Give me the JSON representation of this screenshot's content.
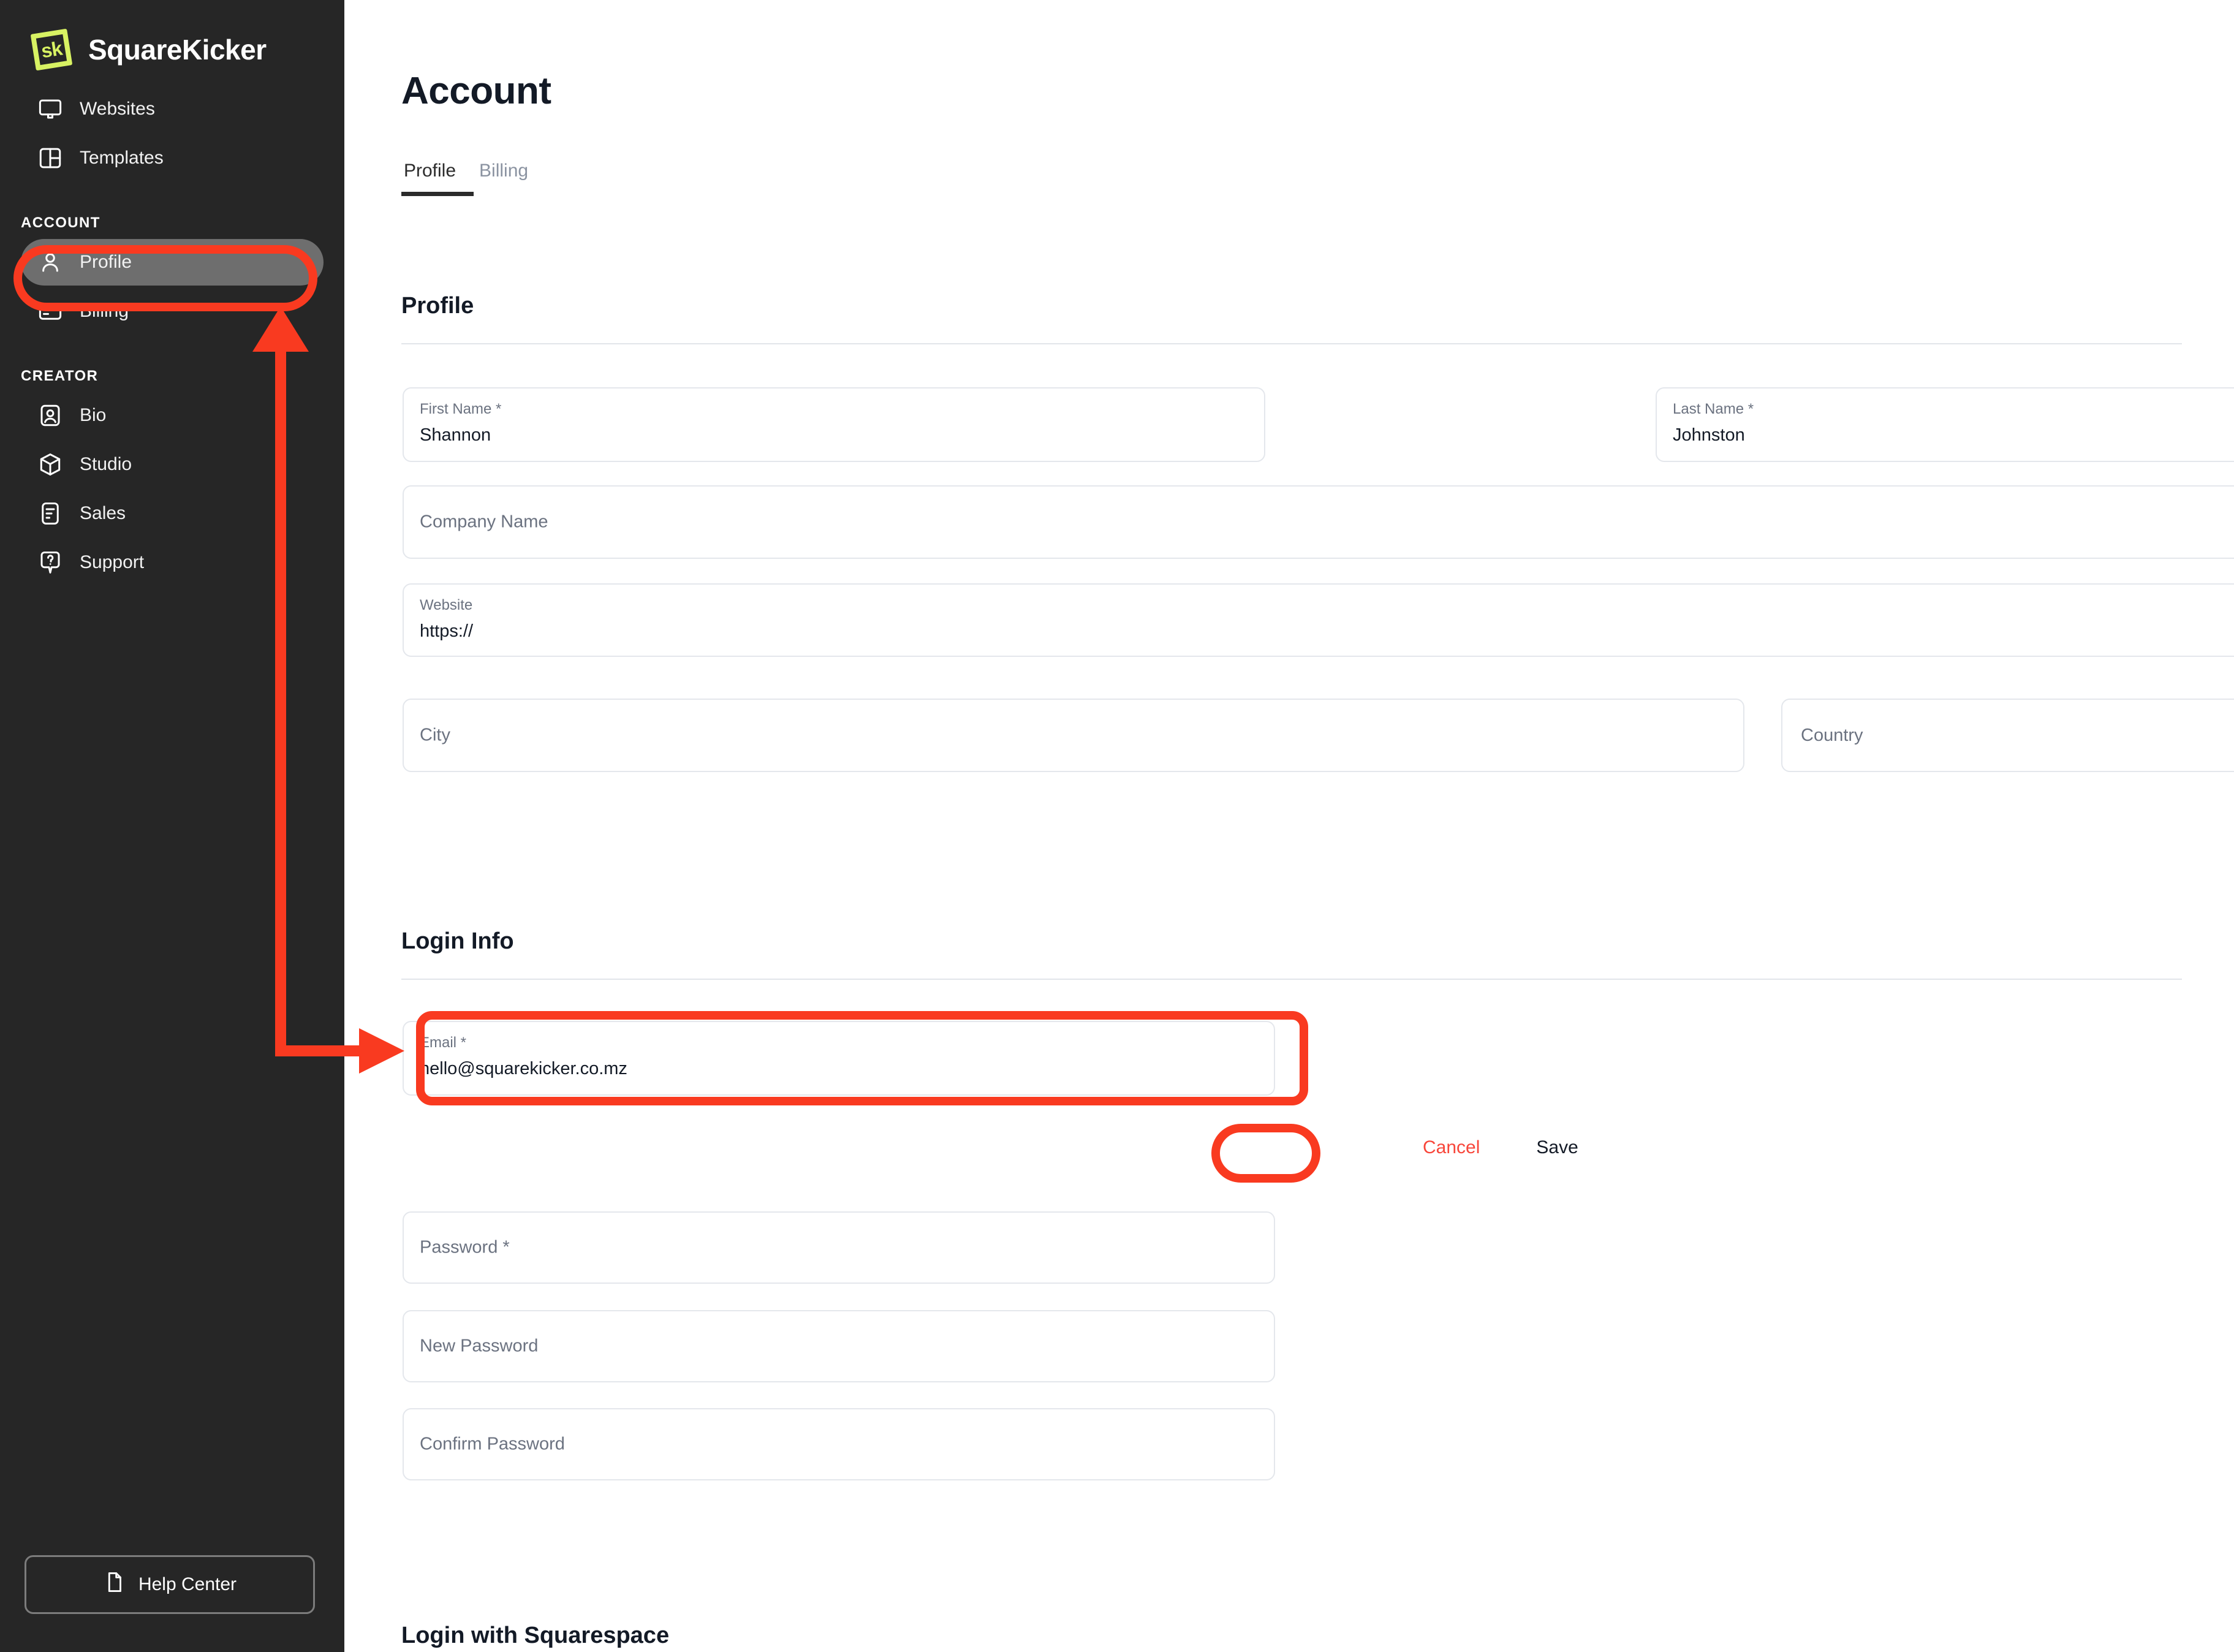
{
  "brand": {
    "logo_mark_text": "sk",
    "name": "SquareKicker",
    "logo_color": "#d8f263"
  },
  "sidebar": {
    "top_items": [
      {
        "label": "Websites",
        "icon": "monitor-icon"
      },
      {
        "label": "Templates",
        "icon": "layout-panel-icon"
      }
    ],
    "account_section_label": "ACCOUNT",
    "account_items": [
      {
        "label": "Profile",
        "icon": "user-icon",
        "active": true
      },
      {
        "label": "Billing",
        "icon": "credit-card-icon",
        "active": false
      }
    ],
    "creator_section_label": "CREATOR",
    "creator_items": [
      {
        "label": "Bio",
        "icon": "id-card-icon"
      },
      {
        "label": "Studio",
        "icon": "cube-icon"
      },
      {
        "label": "Sales",
        "icon": "document-list-icon"
      },
      {
        "label": "Support",
        "icon": "question-bubble-icon"
      }
    ],
    "help_button": {
      "label": "Help Center",
      "icon": "document-icon"
    }
  },
  "header": {
    "title": "Account",
    "tabs": [
      {
        "label": "Profile",
        "active": true
      },
      {
        "label": "Billing",
        "active": false
      }
    ]
  },
  "profile_section": {
    "heading": "Profile",
    "first_name": {
      "label": "First Name *",
      "value": "Shannon"
    },
    "last_name": {
      "label": "Last Name *",
      "value": "Johnston"
    },
    "company_name": {
      "placeholder": "Company Name",
      "value": ""
    },
    "website": {
      "label": "Website",
      "value": "https://"
    },
    "city": {
      "placeholder": "City",
      "value": ""
    },
    "country": {
      "placeholder": "Country",
      "value": "",
      "icon": "chevron-down-icon"
    }
  },
  "login_info_section": {
    "heading": "Login Info",
    "email": {
      "label": "Email *",
      "value": "hello@squarekicker.co.mz"
    },
    "cancel_label": "Cancel",
    "save_label": "Save",
    "password": {
      "placeholder": "Password *",
      "value": ""
    },
    "new_password": {
      "placeholder": "New Password",
      "value": ""
    },
    "confirm_password": {
      "placeholder": "Confirm Password",
      "value": ""
    }
  },
  "squarespace_section": {
    "heading": "Login with Squarespace"
  },
  "annotations": {
    "color": "#f93a20",
    "profile_nav_highlight": true,
    "email_field_highlight": true,
    "save_button_highlight": true,
    "arrow": "elbow-arrow-from-email-field-to-profile-nav"
  }
}
